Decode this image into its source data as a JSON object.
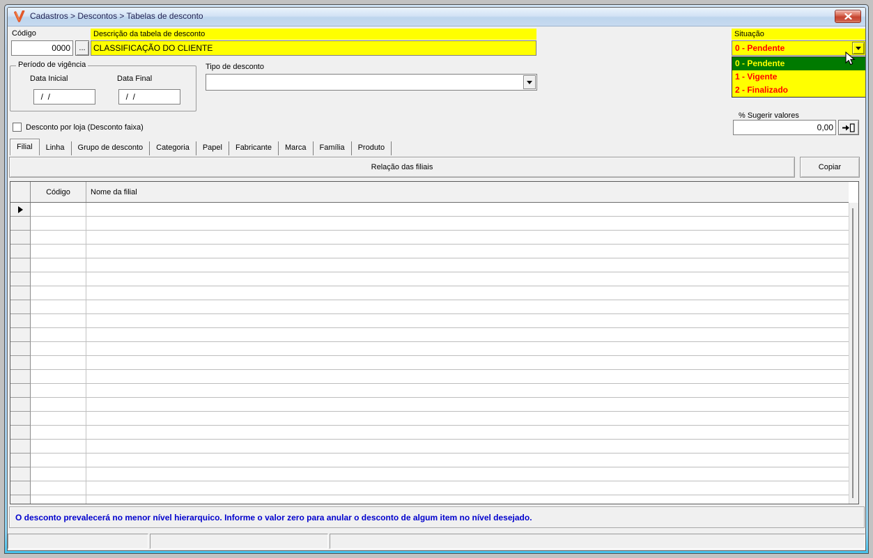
{
  "window": {
    "title": "Cadastros > Descontos > Tabelas de desconto"
  },
  "header": {
    "codigo_label": "Código",
    "codigo_value": "0000",
    "browse_button": "...",
    "descricao_label": "Descrição da tabela de desconto",
    "descricao_value": "CLASSIFICAÇÃO DO CLIENTE",
    "situacao_label": "Situação",
    "situacao_value": "0 - Pendente",
    "situacao_options": [
      "0 - Pendente",
      "1 - Vigente",
      "2 - Finalizado"
    ],
    "situacao_selected_index": 0
  },
  "periodo": {
    "legend": "Período de vigência",
    "data_inicial_label": "Data Inicial",
    "data_final_label": "Data Final",
    "data_inicial_value": "  /  /",
    "data_final_value": "  /  /"
  },
  "tipo_desconto": {
    "label": "Tipo de desconto",
    "value": ""
  },
  "sugerir": {
    "label": "% Sugerir valores",
    "value": "0,00"
  },
  "desconto_loja": {
    "label": "Desconto por loja (Desconto faixa)",
    "checked": false
  },
  "tabs": {
    "items": [
      "Filial",
      "Linha",
      "Grupo de desconto",
      "Categoria",
      "Papel",
      "Fabricante",
      "Marca",
      "Família",
      "Produto"
    ],
    "active": "Filial"
  },
  "filiais_panel": {
    "title": "Relação das filiais",
    "copy_button": "Copiar"
  },
  "grid": {
    "columns": [
      "Código",
      "Nome da filial"
    ],
    "row_count": 22,
    "current_row_index": 0,
    "rows": []
  },
  "footer": {
    "message": "O desconto prevalecerá no menor nível hierarquico. Informe o valor zero para anular o desconto de algum item no nível desejado.",
    "status_panels": [
      "",
      "",
      ""
    ]
  },
  "colors": {
    "field_yellow": "#ffff00",
    "text_red": "#ff0000",
    "selected_green": "#007a00",
    "message_blue": "#0000cd",
    "close_red": "#c64430"
  }
}
